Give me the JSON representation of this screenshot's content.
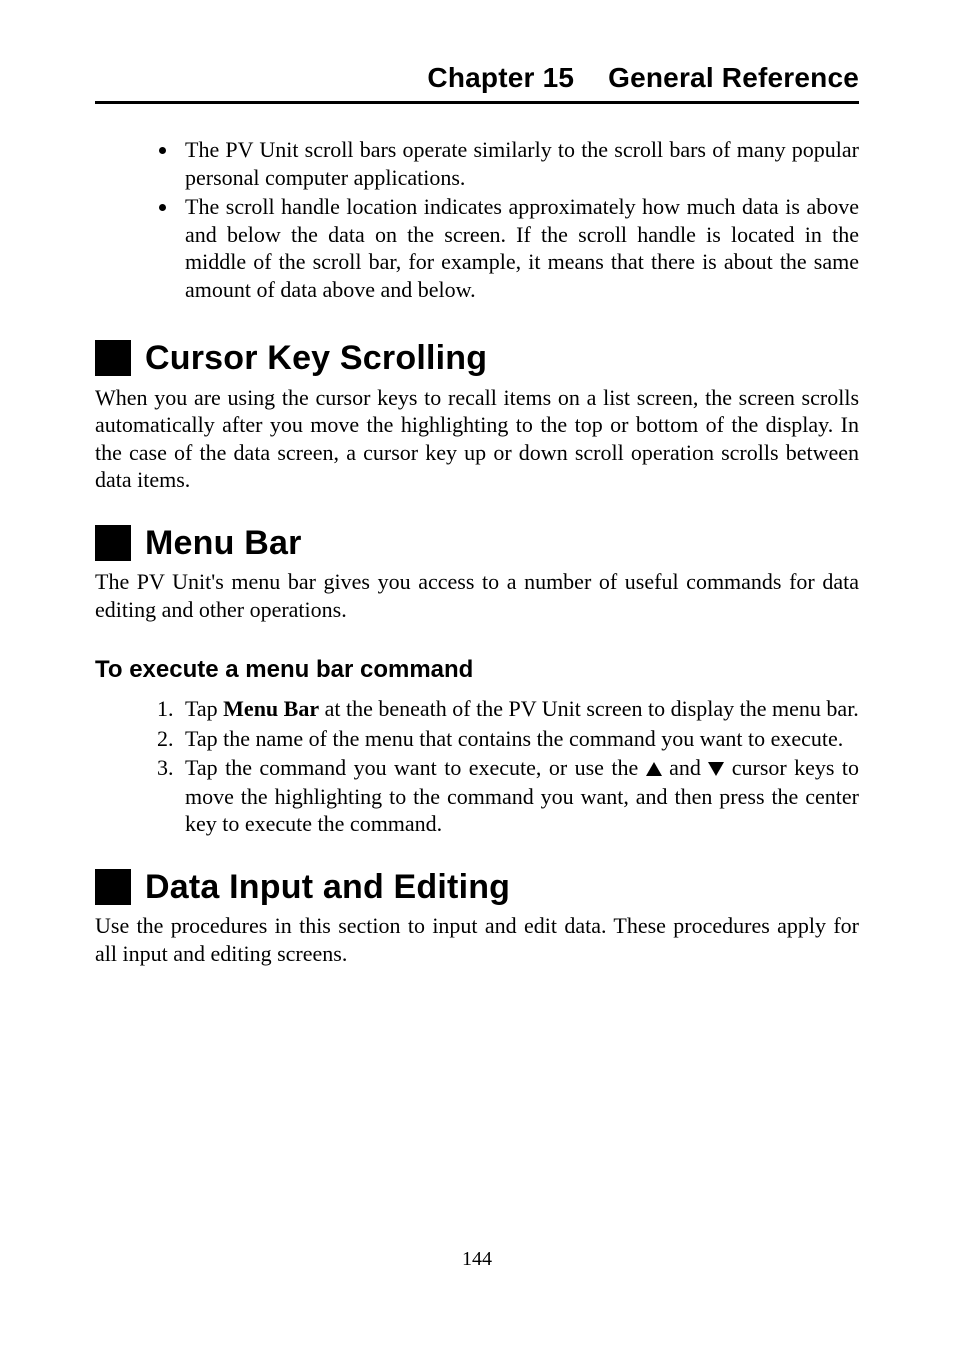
{
  "header": {
    "chapter_label": "Chapter 15",
    "chapter_title": "General Reference"
  },
  "top_bullets": [
    "The PV Unit scroll bars operate similarly to the scroll bars of many popular personal computer applications.",
    "The scroll handle location indicates approximately how much data is above and below the data on the screen. If the scroll handle is located in the middle of the scroll bar, for example, it means that there is about the same amount of data above and below."
  ],
  "sections": {
    "cursor": {
      "title": "Cursor Key Scrolling",
      "para": "When you are using the cursor keys to recall items on a list screen, the screen scrolls automatically after you move the highlighting to the top or bottom of the display. In the case of the data screen, a cursor key up or down scroll operation scrolls between data items."
    },
    "menubar": {
      "title": "Menu Bar",
      "para": "The PV Unit's menu bar gives you access to a number of useful commands for data editing and other operations.",
      "subhead": "To execute a menu bar command",
      "steps": {
        "s1_a": "Tap ",
        "s1_bold": "Menu Bar",
        "s1_b": " at the beneath of the PV Unit screen to display the menu bar.",
        "s2": "Tap the name of the menu that contains the command you want to execute.",
        "s3_a": "Tap the command you want to execute, or use the ",
        "s3_b": " and ",
        "s3_c": " cursor keys to move the highlighting to the command you want, and then press the center key to execute the command."
      }
    },
    "datainput": {
      "title": "Data Input and Editing",
      "para": "Use the procedures in this section to input and edit data. These procedures apply for all input and editing screens."
    }
  },
  "page_number": "144"
}
